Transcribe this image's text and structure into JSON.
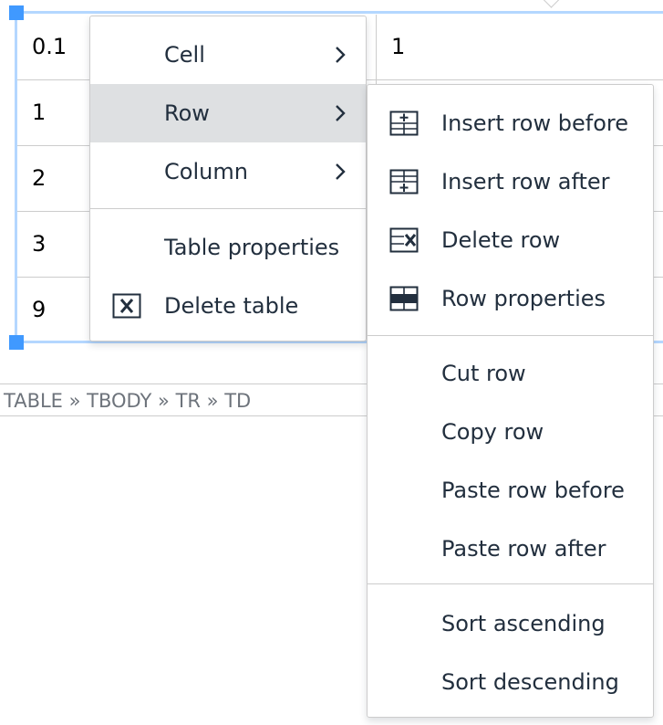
{
  "table": {
    "rows": [
      {
        "col1": "0.1",
        "col2": "1"
      },
      {
        "col1": "1",
        "col2": ""
      },
      {
        "col1": "2",
        "col2": ""
      },
      {
        "col1": "3",
        "col2": ""
      },
      {
        "col1": "9",
        "col2": ""
      }
    ]
  },
  "statusbar": {
    "path": "TABLE » TBODY » TR » TD"
  },
  "context_menu": {
    "items": [
      {
        "label": "Cell",
        "icon": "",
        "submenu": true
      },
      {
        "label": "Row",
        "icon": "",
        "submenu": true,
        "active": true
      },
      {
        "label": "Column",
        "icon": "",
        "submenu": true
      },
      {
        "label": "Table properties",
        "icon": ""
      },
      {
        "label": "Delete table",
        "icon": "table-delete-icon"
      }
    ]
  },
  "row_submenu": {
    "items": [
      {
        "label": "Insert row before",
        "icon": "insert-row-before-icon"
      },
      {
        "label": "Insert row after",
        "icon": "insert-row-after-icon"
      },
      {
        "label": "Delete row",
        "icon": "delete-row-icon"
      },
      {
        "label": "Row properties",
        "icon": "row-properties-icon"
      },
      {
        "label": "Cut row",
        "icon": ""
      },
      {
        "label": "Copy row",
        "icon": ""
      },
      {
        "label": "Paste row before",
        "icon": ""
      },
      {
        "label": "Paste row after",
        "icon": ""
      },
      {
        "label": "Sort ascending",
        "icon": ""
      },
      {
        "label": "Sort descending",
        "icon": ""
      }
    ]
  },
  "colors": {
    "selection_frame": "#b4d7ff",
    "handle": "#4099ff",
    "active_item": "#dee0e2",
    "text": "#222f3e",
    "status_text": "#6d737b"
  }
}
